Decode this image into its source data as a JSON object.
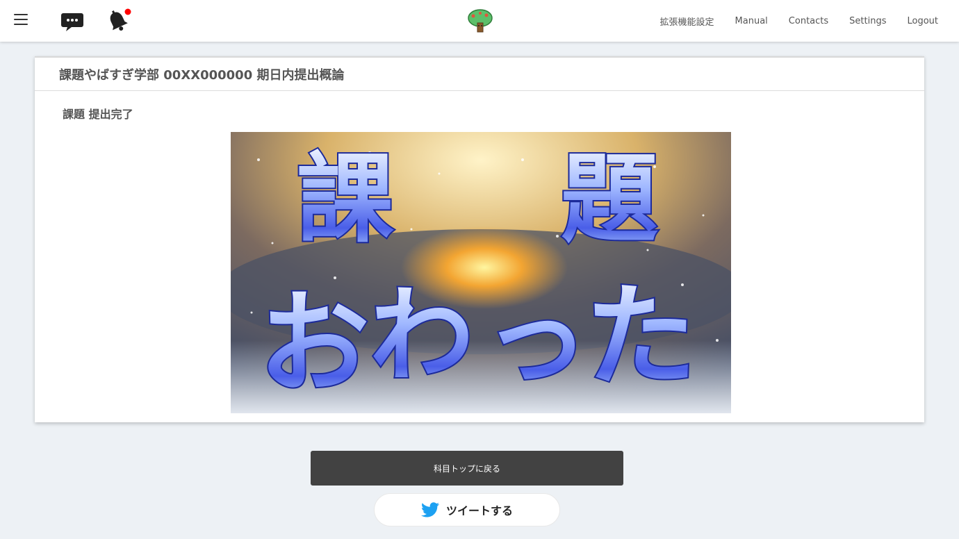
{
  "header": {
    "nav": [
      "拡張機能設定",
      "Manual",
      "Contacts",
      "Settings",
      "Logout"
    ]
  },
  "card": {
    "title": "課題やばすぎ学部 00XX000000 期日内提出概論",
    "subtitle": "課題 提出完了"
  },
  "hero": {
    "line1": [
      "課",
      "題"
    ],
    "line2": [
      "お",
      "わ",
      "っ",
      "た"
    ]
  },
  "buttons": {
    "back_label": "科目トップに戻る",
    "tweet_label": "ツイートする"
  },
  "colors": {
    "header_bg": "#ffffff",
    "page_bg": "#edf1f5",
    "back_button_bg": "#424242",
    "twitter_blue": "#1da1f2",
    "notification_dot": "#ff0000"
  },
  "icons": [
    "hamburger-icon",
    "chat-icon",
    "bell-icon",
    "tree-logo-icon",
    "twitter-bird-icon"
  ]
}
